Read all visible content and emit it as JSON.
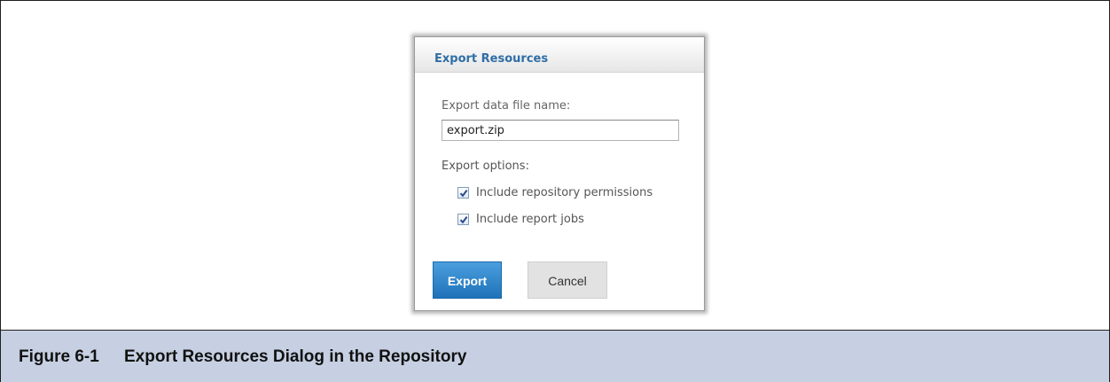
{
  "dialog": {
    "title": "Export Resources",
    "file_name_label": "Export data file name:",
    "file_name_value": "export.zip",
    "options_label": "Export options:",
    "options": [
      {
        "label": "Include repository permissions",
        "checked": true
      },
      {
        "label": "Include report jobs",
        "checked": true
      }
    ],
    "buttons": {
      "export_label": "Export",
      "cancel_label": "Cancel"
    }
  },
  "caption": {
    "number": "Figure 6-1",
    "text": "Export Resources Dialog in the Repository"
  },
  "colors": {
    "title": "#2f6ea5",
    "export_button": "#2a86cc",
    "caption_bar": "#c6d0e2"
  },
  "icons": {
    "checkbox_checked": "checkmark-icon"
  }
}
